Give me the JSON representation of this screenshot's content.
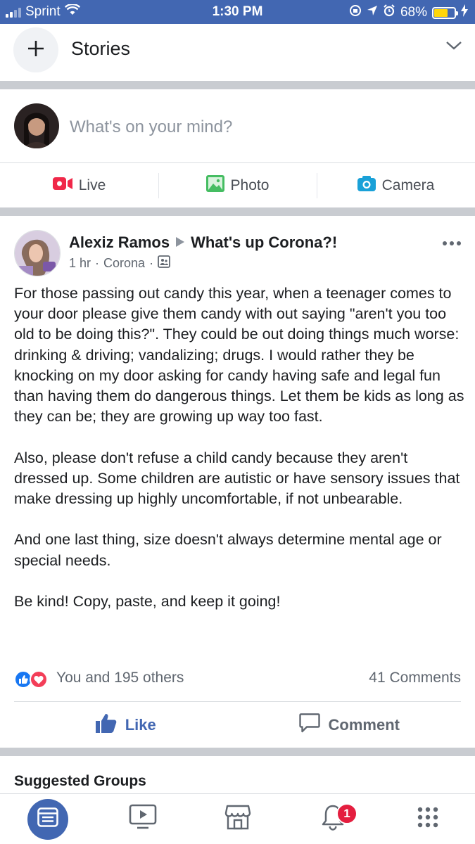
{
  "status_bar": {
    "carrier": "Sprint",
    "time": "1:30 PM",
    "battery_percent": "68%",
    "battery_level": 0.68,
    "icons": [
      "signal-icon",
      "wifi-icon",
      "screen-lock-icon",
      "location-icon",
      "alarm-icon",
      "battery-icon",
      "charging-icon"
    ]
  },
  "stories": {
    "title": "Stories",
    "add_icon": "plus-icon",
    "expand_icon": "chevron-down-icon"
  },
  "composer": {
    "placeholder": "What's on your mind?",
    "actions": [
      {
        "label": "Live",
        "icon": "live-video-icon",
        "color": "#f02849"
      },
      {
        "label": "Photo",
        "icon": "photo-icon",
        "color": "#45bd62"
      },
      {
        "label": "Camera",
        "icon": "camera-icon",
        "color": "#1aa1d8"
      }
    ]
  },
  "post": {
    "author": "Alexiz Ramos",
    "target_group": "What's up Corona?!",
    "time": "1 hr",
    "location": "Corona",
    "audience_icon": "group-audience-icon",
    "paragraphs": [
      "For those passing out candy this year, when a teenager comes to your door please give them candy with out saying \"aren't you too old to be doing this?\". They could be out doing things much worse: drinking & driving; vandalizing; drugs. I would rather they be knocking on my door asking for candy having safe and legal fun than having them do dangerous things. Let them be kids as long as they can be; they are growing up way too fast.",
      "Also, please don't refuse a child candy because they aren't dressed up. Some children are autistic or have sensory issues that make dressing up highly uncomfortable, if not unbearable.",
      "And one last thing, size doesn't always determine mental age or special needs.",
      "Be kind! Copy, paste, and keep it going!"
    ],
    "reactions_text": "You and 195 others",
    "comments_text": "41 Comments",
    "like_label": "Like",
    "comment_label": "Comment",
    "like_color": "#4267b2"
  },
  "suggested_groups": {
    "title": "Suggested Groups"
  },
  "tab_bar": {
    "tabs": [
      {
        "name": "news-feed",
        "icon": "news-feed-icon",
        "active": true
      },
      {
        "name": "watch",
        "icon": "watch-icon"
      },
      {
        "name": "marketplace",
        "icon": "marketplace-icon"
      },
      {
        "name": "notifications",
        "icon": "bell-icon",
        "badge": "1"
      },
      {
        "name": "menu",
        "icon": "menu-grid-icon"
      }
    ]
  },
  "colors": {
    "brand": "#4267b2",
    "divider": "#c9ccd1",
    "secondary_text": "#606770",
    "badge": "#e41e3f"
  }
}
